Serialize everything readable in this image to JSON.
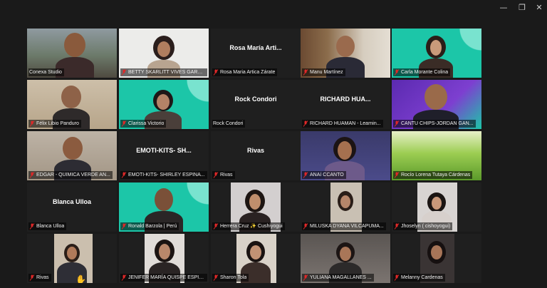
{
  "window": {
    "minimize_glyph": "—",
    "restore_glyph": "❐",
    "close_glyph": "✕"
  },
  "icons": {
    "muted": "muted-mic-icon",
    "hand": "raised-hand-icon"
  },
  "colors": {
    "active_border": "#2fb24a",
    "brand_teal": "#1cc6a8",
    "muted_red": "#e02828"
  },
  "participants": [
    {
      "label": "Conexa Studio",
      "center_name": "",
      "muted": false,
      "active": true
    },
    {
      "label": "BETTY SKARLITT VIVES GARCIA",
      "center_name": "",
      "muted": true
    },
    {
      "label": "Rosa Maria Artica Zárate",
      "center_name": "Rosa María Arti...",
      "muted": true
    },
    {
      "label": "Manu Martínez",
      "center_name": "",
      "muted": true
    },
    {
      "label": "Carla Morante Colina",
      "center_name": "",
      "muted": true
    },
    {
      "label": "Félix Libio Panduro",
      "center_name": "",
      "muted": true
    },
    {
      "label": "Clarissa Victorio",
      "center_name": "",
      "muted": true
    },
    {
      "label": "Rock Condori",
      "center_name": "Rock Condori",
      "muted": false
    },
    {
      "label": "RICHARD HUAMAN - Learnin...",
      "center_name": "RICHARD HUA...",
      "muted": true
    },
    {
      "label": "CANTU CHIPS-JORDAN GAN...",
      "center_name": "",
      "muted": true
    },
    {
      "label": "EDGAR - QUIMICA VERDE AN...",
      "center_name": "",
      "muted": true
    },
    {
      "label": "EMOTI-KITS- SHIRLEY ESPINA...",
      "center_name": "EMOTI-KITS- SH...",
      "muted": true
    },
    {
      "label": "Rivas",
      "center_name": "Rivas",
      "muted": true
    },
    {
      "label": "ANAí CCANTO",
      "center_name": "",
      "muted": true
    },
    {
      "label": "Rocío Lorena Tutaya Cárdenas",
      "center_name": "",
      "muted": true
    },
    {
      "label": "Blanca Ulloa",
      "center_name": "Blanca Ulloa",
      "muted": true
    },
    {
      "label": "Ronald Barzola | Perú",
      "center_name": "",
      "muted": true
    },
    {
      "label": "Herrera Cruz ✨ Cushiyogui",
      "center_name": "",
      "muted": true
    },
    {
      "label": "MILUSKA DYANA VILCAPUMA...",
      "center_name": "",
      "muted": true
    },
    {
      "label": "Jhoselyn ( cishoyogui)",
      "center_name": "",
      "muted": true
    },
    {
      "label": "Rivas",
      "center_name": "",
      "muted": true,
      "hand": true
    },
    {
      "label": "JENIFER MARÍA QUISPE ESPIN...",
      "center_name": "",
      "muted": true
    },
    {
      "label": "Sharon Tola",
      "center_name": "",
      "muted": true
    },
    {
      "label": "YULIANA MAGALLANES ...",
      "center_name": "",
      "muted": true
    },
    {
      "label": "Melanny Cardenas",
      "center_name": "",
      "muted": true
    }
  ]
}
